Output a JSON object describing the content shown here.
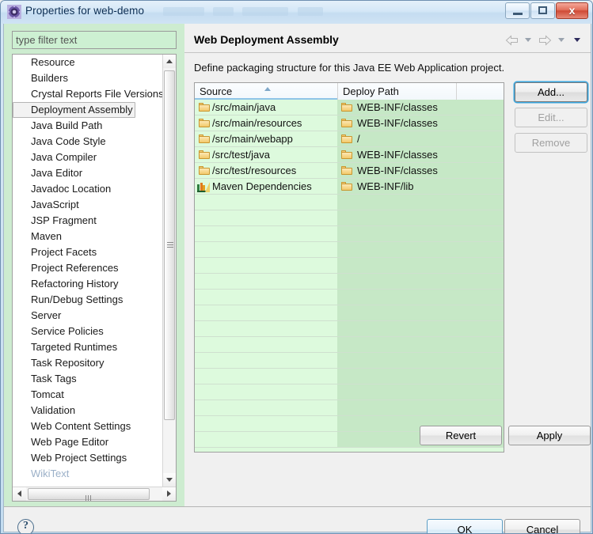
{
  "window": {
    "title": "Properties for web-demo",
    "icon": "properties-gear-icon",
    "minimize_label": "",
    "maximize_label": "",
    "close_label": "x"
  },
  "sidebar": {
    "filter": {
      "value": "",
      "placeholder": "type filter text"
    },
    "items": [
      {
        "label": "Resource",
        "selected": false
      },
      {
        "label": "Builders",
        "selected": false
      },
      {
        "label": "Crystal Reports File Versions",
        "selected": false
      },
      {
        "label": "Deployment Assembly",
        "selected": true
      },
      {
        "label": "Java Build Path",
        "selected": false
      },
      {
        "label": "Java Code Style",
        "selected": false
      },
      {
        "label": "Java Compiler",
        "selected": false
      },
      {
        "label": "Java Editor",
        "selected": false
      },
      {
        "label": "Javadoc Location",
        "selected": false
      },
      {
        "label": "JavaScript",
        "selected": false
      },
      {
        "label": "JSP Fragment",
        "selected": false
      },
      {
        "label": "Maven",
        "selected": false
      },
      {
        "label": "Project Facets",
        "selected": false
      },
      {
        "label": "Project References",
        "selected": false
      },
      {
        "label": "Refactoring History",
        "selected": false
      },
      {
        "label": "Run/Debug Settings",
        "selected": false
      },
      {
        "label": "Server",
        "selected": false
      },
      {
        "label": "Service Policies",
        "selected": false
      },
      {
        "label": "Targeted Runtimes",
        "selected": false
      },
      {
        "label": "Task Repository",
        "selected": false
      },
      {
        "label": "Task Tags",
        "selected": false
      },
      {
        "label": "Tomcat",
        "selected": false
      },
      {
        "label": "Validation",
        "selected": false
      },
      {
        "label": "Web Content Settings",
        "selected": false
      },
      {
        "label": "Web Page Editor",
        "selected": false
      },
      {
        "label": "Web Project Settings",
        "selected": false
      },
      {
        "label": "WikiText",
        "selected": false,
        "clipped": true
      }
    ]
  },
  "main": {
    "title": "Web Deployment Assembly",
    "description": "Define packaging structure for this Java EE Web Application project.",
    "nav": {
      "back_icon": "back-arrow-icon",
      "back_menu_icon": "chevron-down-icon",
      "forward_icon": "forward-arrow-icon",
      "forward_menu_icon": "chevron-down-icon",
      "menu_icon": "chevron-down-icon"
    },
    "table": {
      "columns": [
        "Source",
        "Deploy Path",
        ""
      ],
      "sort_column": "Source",
      "sort_direction": "ascending",
      "rows": [
        {
          "source": "/src/main/java",
          "source_icon": "folder-icon",
          "deploy": "WEB-INF/classes",
          "deploy_icon": "folder-icon"
        },
        {
          "source": "/src/main/resources",
          "source_icon": "folder-icon",
          "deploy": "WEB-INF/classes",
          "deploy_icon": "folder-icon"
        },
        {
          "source": "/src/main/webapp",
          "source_icon": "folder-icon",
          "deploy": "/",
          "deploy_icon": "folder-icon"
        },
        {
          "source": "/src/test/java",
          "source_icon": "folder-icon",
          "deploy": "WEB-INF/classes",
          "deploy_icon": "folder-icon"
        },
        {
          "source": "/src/test/resources",
          "source_icon": "folder-icon",
          "deploy": "WEB-INF/classes",
          "deploy_icon": "folder-icon"
        },
        {
          "source": "Maven Dependencies",
          "source_icon": "maven-dependencies-icon",
          "deploy": "WEB-INF/lib",
          "deploy_icon": "folder-icon"
        }
      ],
      "empty_row_count": 16
    },
    "buttons": {
      "add": "Add...",
      "edit": "Edit...",
      "remove": "Remove",
      "revert": "Revert",
      "apply": "Apply"
    }
  },
  "footer": {
    "help_icon": "help-question-icon",
    "ok": "OK",
    "cancel": "Cancel"
  },
  "colors": {
    "table_source_bg": "#ddfadd",
    "table_deploy_bg": "#c6e8c6",
    "sidebar_bg": "#cdecd0",
    "title_text": "#0b2d52",
    "focus_ring": "#3aa7e0"
  }
}
